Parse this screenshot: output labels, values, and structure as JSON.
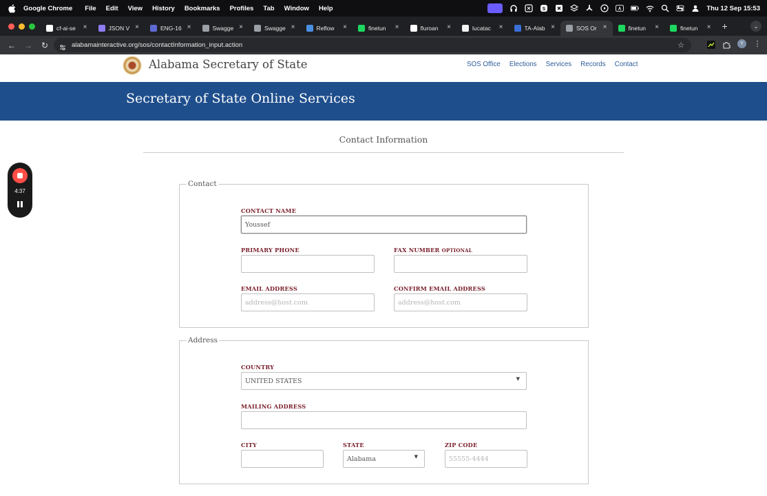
{
  "menubar": {
    "app_name": "Google Chrome",
    "items": [
      "File",
      "Edit",
      "View",
      "History",
      "Bookmarks",
      "Profiles",
      "Tab",
      "Window",
      "Help"
    ],
    "clock": "Thu 12 Sep  15:53"
  },
  "tabs": [
    {
      "label": "cf-ai-se",
      "icon": "github-icon",
      "color": "#ffffff"
    },
    {
      "label": "JSON V",
      "icon": "json-icon",
      "color": "#8e7cf0"
    },
    {
      "label": "ENG-16",
      "icon": "linear-icon",
      "color": "#5e6ad2"
    },
    {
      "label": "Swagge",
      "icon": "swagger-icon",
      "color": "#9aa0a6"
    },
    {
      "label": "Swagge",
      "icon": "swagger-icon",
      "color": "#9aa0a6"
    },
    {
      "label": "Reflow",
      "icon": "reflow-icon",
      "color": "#4a90e2"
    },
    {
      "label": "finetun",
      "icon": "chart-icon",
      "color": "#1ed760"
    },
    {
      "label": "fluroan",
      "icon": "google-icon",
      "color": "#ffffff"
    },
    {
      "label": "lucatac",
      "icon": "doc-icon",
      "color": "#f5f5f5"
    },
    {
      "label": "TA-Alab",
      "icon": "shield-icon",
      "color": "#3b6fd6"
    },
    {
      "label": "SOS Or",
      "icon": "globe-icon",
      "color": "#9aa0a6",
      "active": true
    },
    {
      "label": "finetun",
      "icon": "chart-icon",
      "color": "#1ed760"
    },
    {
      "label": "finetun",
      "icon": "chart-icon",
      "color": "#1ed760"
    }
  ],
  "address_bar": {
    "url": "alabamainteractive.org/sos/contactInformation_input.action"
  },
  "site": {
    "title": "Alabama Secretary of State",
    "nav": [
      "SOS Office",
      "Elections",
      "Services",
      "Records",
      "Contact"
    ],
    "banner_title": "Secretary of State Online Services",
    "section_title": "Contact Information"
  },
  "contact": {
    "legend": "Contact",
    "name_label": "CONTACT NAME",
    "name_value": "Youssef",
    "phone_label": "PRIMARY PHONE",
    "phone_value": "",
    "fax_label": "FAX NUMBER",
    "fax_optional": "OPTIONAL",
    "fax_value": "",
    "email_label": "EMAIL ADDRESS",
    "email_placeholder": "address@host.com",
    "confirm_email_label": "CONFIRM EMAIL ADDRESS",
    "confirm_email_placeholder": "address@host.com"
  },
  "address": {
    "legend": "Address",
    "country_label": "COUNTRY",
    "country_value": "UNITED STATES",
    "mailing_label": "MAILING ADDRESS",
    "mailing_value": "",
    "city_label": "CITY",
    "city_value": "",
    "state_label": "STATE",
    "state_value": "Alabama",
    "zip_label": "ZIP CODE",
    "zip_placeholder": "55555-4444"
  },
  "recorder": {
    "time": "4:37"
  },
  "colors": {
    "banner": "#1f4e8c",
    "label": "#7a1f2b",
    "nav_link": "#2e5d9a",
    "record": "#ff4d47"
  }
}
